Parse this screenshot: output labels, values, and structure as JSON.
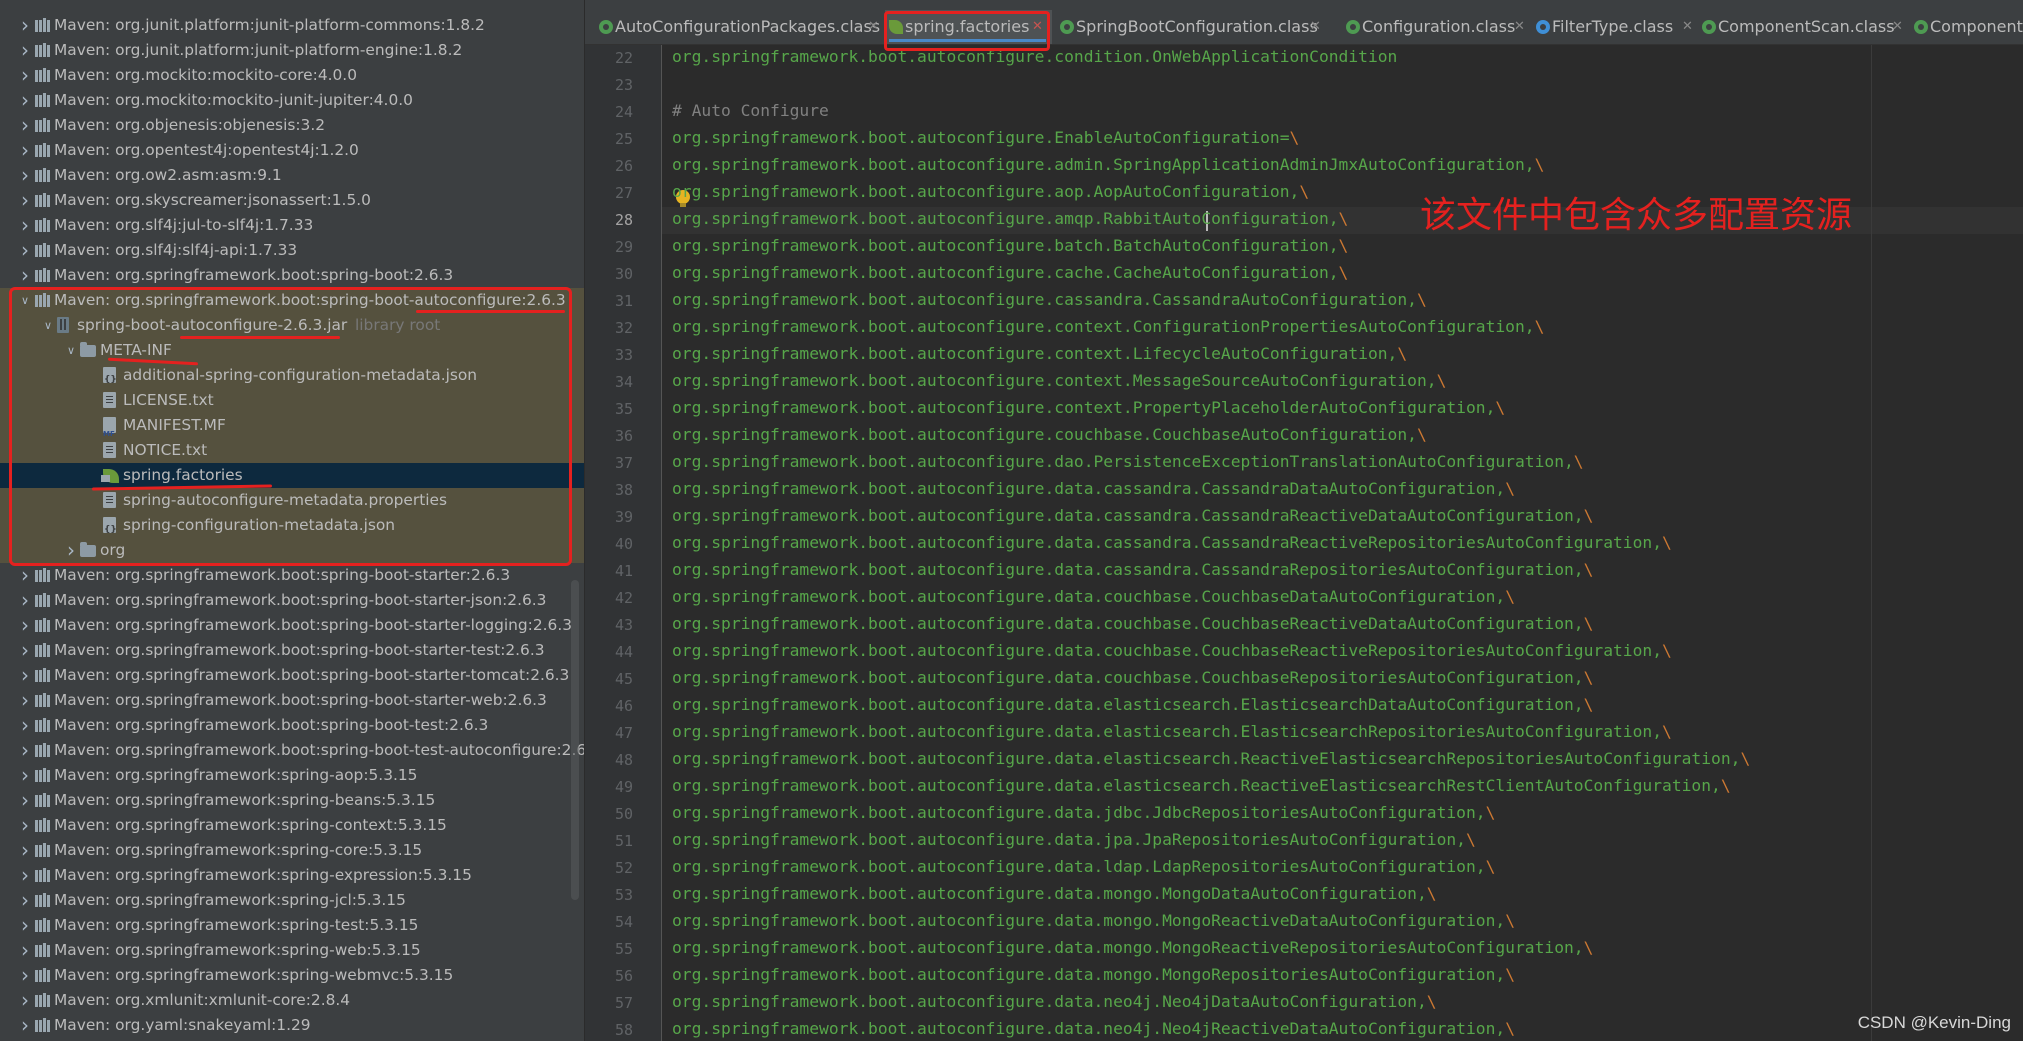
{
  "tree": {
    "rows": [
      {
        "label": "Maven: org.junit.platform:junit-platform-commons:1.8.2",
        "indent": 0,
        "chevron": "right",
        "icon": "library"
      },
      {
        "label": "Maven: org.junit.platform:junit-platform-engine:1.8.2",
        "indent": 0,
        "chevron": "right",
        "icon": "library"
      },
      {
        "label": "Maven: org.mockito:mockito-core:4.0.0",
        "indent": 0,
        "chevron": "right",
        "icon": "library"
      },
      {
        "label": "Maven: org.mockito:mockito-junit-jupiter:4.0.0",
        "indent": 0,
        "chevron": "right",
        "icon": "library"
      },
      {
        "label": "Maven: org.objenesis:objenesis:3.2",
        "indent": 0,
        "chevron": "right",
        "icon": "library"
      },
      {
        "label": "Maven: org.opentest4j:opentest4j:1.2.0",
        "indent": 0,
        "chevron": "right",
        "icon": "library"
      },
      {
        "label": "Maven: org.ow2.asm:asm:9.1",
        "indent": 0,
        "chevron": "right",
        "icon": "library"
      },
      {
        "label": "Maven: org.skyscreamer:jsonassert:1.5.0",
        "indent": 0,
        "chevron": "right",
        "icon": "library"
      },
      {
        "label": "Maven: org.slf4j:jul-to-slf4j:1.7.33",
        "indent": 0,
        "chevron": "right",
        "icon": "library"
      },
      {
        "label": "Maven: org.slf4j:slf4j-api:1.7.33",
        "indent": 0,
        "chevron": "right",
        "icon": "library"
      },
      {
        "label": "Maven: org.springframework.boot:spring-boot:2.6.3",
        "indent": 0,
        "chevron": "right",
        "icon": "library"
      },
      {
        "label": "Maven: org.springframework.boot:spring-boot-autoconfigure:2.6.3",
        "indent": 0,
        "chevron": "down",
        "icon": "library",
        "highlight": true
      },
      {
        "label": "spring-boot-autoconfigure-2.6.3.jar",
        "sub": "library root",
        "indent": 1,
        "chevron": "down",
        "icon": "jar",
        "highlight": true
      },
      {
        "label": "META-INF",
        "indent": 2,
        "chevron": "down",
        "icon": "folder",
        "highlight": true
      },
      {
        "label": "additional-spring-configuration-metadata.json",
        "indent": 3,
        "chevron": "",
        "icon": "json",
        "highlight": true
      },
      {
        "label": "LICENSE.txt",
        "indent": 3,
        "chevron": "",
        "icon": "file",
        "highlight": true
      },
      {
        "label": "MANIFEST.MF",
        "indent": 3,
        "chevron": "",
        "icon": "mf",
        "highlight": true
      },
      {
        "label": "NOTICE.txt",
        "indent": 3,
        "chevron": "",
        "icon": "file",
        "highlight": true
      },
      {
        "label": "spring.factories",
        "indent": 3,
        "chevron": "",
        "icon": "leaf",
        "selected": true
      },
      {
        "label": "spring-autoconfigure-metadata.properties",
        "indent": 3,
        "chevron": "",
        "icon": "file",
        "highlight": true
      },
      {
        "label": "spring-configuration-metadata.json",
        "indent": 3,
        "chevron": "",
        "icon": "json",
        "highlight": true
      },
      {
        "label": "org",
        "indent": 2,
        "chevron": "right",
        "icon": "folder",
        "highlight": true
      },
      {
        "label": "Maven: org.springframework.boot:spring-boot-starter:2.6.3",
        "indent": 0,
        "chevron": "right",
        "icon": "library"
      },
      {
        "label": "Maven: org.springframework.boot:spring-boot-starter-json:2.6.3",
        "indent": 0,
        "chevron": "right",
        "icon": "library"
      },
      {
        "label": "Maven: org.springframework.boot:spring-boot-starter-logging:2.6.3",
        "indent": 0,
        "chevron": "right",
        "icon": "library"
      },
      {
        "label": "Maven: org.springframework.boot:spring-boot-starter-test:2.6.3",
        "indent": 0,
        "chevron": "right",
        "icon": "library"
      },
      {
        "label": "Maven: org.springframework.boot:spring-boot-starter-tomcat:2.6.3",
        "indent": 0,
        "chevron": "right",
        "icon": "library"
      },
      {
        "label": "Maven: org.springframework.boot:spring-boot-starter-web:2.6.3",
        "indent": 0,
        "chevron": "right",
        "icon": "library"
      },
      {
        "label": "Maven: org.springframework.boot:spring-boot-test:2.6.3",
        "indent": 0,
        "chevron": "right",
        "icon": "library"
      },
      {
        "label": "Maven: org.springframework.boot:spring-boot-test-autoconfigure:2.6.",
        "indent": 0,
        "chevron": "right",
        "icon": "library"
      },
      {
        "label": "Maven: org.springframework:spring-aop:5.3.15",
        "indent": 0,
        "chevron": "right",
        "icon": "library"
      },
      {
        "label": "Maven: org.springframework:spring-beans:5.3.15",
        "indent": 0,
        "chevron": "right",
        "icon": "library"
      },
      {
        "label": "Maven: org.springframework:spring-context:5.3.15",
        "indent": 0,
        "chevron": "right",
        "icon": "library"
      },
      {
        "label": "Maven: org.springframework:spring-core:5.3.15",
        "indent": 0,
        "chevron": "right",
        "icon": "library"
      },
      {
        "label": "Maven: org.springframework:spring-expression:5.3.15",
        "indent": 0,
        "chevron": "right",
        "icon": "library"
      },
      {
        "label": "Maven: org.springframework:spring-jcl:5.3.15",
        "indent": 0,
        "chevron": "right",
        "icon": "library"
      },
      {
        "label": "Maven: org.springframework:spring-test:5.3.15",
        "indent": 0,
        "chevron": "right",
        "icon": "library"
      },
      {
        "label": "Maven: org.springframework:spring-web:5.3.15",
        "indent": 0,
        "chevron": "right",
        "icon": "library"
      },
      {
        "label": "Maven: org.springframework:spring-webmvc:5.3.15",
        "indent": 0,
        "chevron": "right",
        "icon": "library"
      },
      {
        "label": "Maven: org.xmlunit:xmlunit-core:2.8.4",
        "indent": 0,
        "chevron": "right",
        "icon": "library"
      },
      {
        "label": "Maven: org.yaml:snakeyaml:1.29",
        "indent": 0,
        "chevron": "right",
        "icon": "library"
      }
    ]
  },
  "tabs": [
    {
      "label": "AutoConfigurationPackages.class",
      "icon": "class-icon"
    },
    {
      "label": "spring.factories",
      "icon": "spring-leaf-icon",
      "active": true
    },
    {
      "label": "SpringBootConfiguration.class",
      "icon": "class-icon"
    },
    {
      "label": "Configuration.class",
      "icon": "class-icon"
    },
    {
      "label": "FilterType.class",
      "icon": "enum-icon"
    },
    {
      "label": "ComponentScan.class",
      "icon": "class-icon"
    },
    {
      "label": "Component",
      "icon": "class-icon"
    }
  ],
  "editor": {
    "current_line": 28,
    "lines": [
      {
        "n": 22,
        "text": "org.springframework.boot.autoconfigure.condition.OnWebApplicationCondition"
      },
      {
        "n": 23,
        "text": ""
      },
      {
        "n": 24,
        "text": "# Auto Configure",
        "comment": true
      },
      {
        "n": 25,
        "text": "org.springframework.boot.autoconfigure.EnableAutoConfiguration=\\"
      },
      {
        "n": 26,
        "text": "org.springframework.boot.autoconfigure.admin.SpringApplicationAdminJmxAutoConfiguration,\\"
      },
      {
        "n": 27,
        "text": "org.springframework.boot.autoconfigure.aop.AopAutoConfiguration,\\"
      },
      {
        "n": 28,
        "text": "org.springframework.boot.autoconfigure.amqp.RabbitAutoConfiguration,\\"
      },
      {
        "n": 29,
        "text": "org.springframework.boot.autoconfigure.batch.BatchAutoConfiguration,\\"
      },
      {
        "n": 30,
        "text": "org.springframework.boot.autoconfigure.cache.CacheAutoConfiguration,\\"
      },
      {
        "n": 31,
        "text": "org.springframework.boot.autoconfigure.cassandra.CassandraAutoConfiguration,\\"
      },
      {
        "n": 32,
        "text": "org.springframework.boot.autoconfigure.context.ConfigurationPropertiesAutoConfiguration,\\"
      },
      {
        "n": 33,
        "text": "org.springframework.boot.autoconfigure.context.LifecycleAutoConfiguration,\\"
      },
      {
        "n": 34,
        "text": "org.springframework.boot.autoconfigure.context.MessageSourceAutoConfiguration,\\"
      },
      {
        "n": 35,
        "text": "org.springframework.boot.autoconfigure.context.PropertyPlaceholderAutoConfiguration,\\"
      },
      {
        "n": 36,
        "text": "org.springframework.boot.autoconfigure.couchbase.CouchbaseAutoConfiguration,\\"
      },
      {
        "n": 37,
        "text": "org.springframework.boot.autoconfigure.dao.PersistenceExceptionTranslationAutoConfiguration,\\"
      },
      {
        "n": 38,
        "text": "org.springframework.boot.autoconfigure.data.cassandra.CassandraDataAutoConfiguration,\\"
      },
      {
        "n": 39,
        "text": "org.springframework.boot.autoconfigure.data.cassandra.CassandraReactiveDataAutoConfiguration,\\"
      },
      {
        "n": 40,
        "text": "org.springframework.boot.autoconfigure.data.cassandra.CassandraReactiveRepositoriesAutoConfiguration,\\"
      },
      {
        "n": 41,
        "text": "org.springframework.boot.autoconfigure.data.cassandra.CassandraRepositoriesAutoConfiguration,\\"
      },
      {
        "n": 42,
        "text": "org.springframework.boot.autoconfigure.data.couchbase.CouchbaseDataAutoConfiguration,\\"
      },
      {
        "n": 43,
        "text": "org.springframework.boot.autoconfigure.data.couchbase.CouchbaseReactiveDataAutoConfiguration,\\"
      },
      {
        "n": 44,
        "text": "org.springframework.boot.autoconfigure.data.couchbase.CouchbaseReactiveRepositoriesAutoConfiguration,\\"
      },
      {
        "n": 45,
        "text": "org.springframework.boot.autoconfigure.data.couchbase.CouchbaseRepositoriesAutoConfiguration,\\"
      },
      {
        "n": 46,
        "text": "org.springframework.boot.autoconfigure.data.elasticsearch.ElasticsearchDataAutoConfiguration,\\"
      },
      {
        "n": 47,
        "text": "org.springframework.boot.autoconfigure.data.elasticsearch.ElasticsearchRepositoriesAutoConfiguration,\\"
      },
      {
        "n": 48,
        "text": "org.springframework.boot.autoconfigure.data.elasticsearch.ReactiveElasticsearchRepositoriesAutoConfiguration,\\"
      },
      {
        "n": 49,
        "text": "org.springframework.boot.autoconfigure.data.elasticsearch.ReactiveElasticsearchRestClientAutoConfiguration,\\"
      },
      {
        "n": 50,
        "text": "org.springframework.boot.autoconfigure.data.jdbc.JdbcRepositoriesAutoConfiguration,\\"
      },
      {
        "n": 51,
        "text": "org.springframework.boot.autoconfigure.data.jpa.JpaRepositoriesAutoConfiguration,\\"
      },
      {
        "n": 52,
        "text": "org.springframework.boot.autoconfigure.data.ldap.LdapRepositoriesAutoConfiguration,\\"
      },
      {
        "n": 53,
        "text": "org.springframework.boot.autoconfigure.data.mongo.MongoDataAutoConfiguration,\\"
      },
      {
        "n": 54,
        "text": "org.springframework.boot.autoconfigure.data.mongo.MongoReactiveDataAutoConfiguration,\\"
      },
      {
        "n": 55,
        "text": "org.springframework.boot.autoconfigure.data.mongo.MongoReactiveRepositoriesAutoConfiguration,\\"
      },
      {
        "n": 56,
        "text": "org.springframework.boot.autoconfigure.data.mongo.MongoRepositoriesAutoConfiguration,\\"
      },
      {
        "n": 57,
        "text": "org.springframework.boot.autoconfigure.data.neo4j.Neo4jDataAutoConfiguration,\\"
      },
      {
        "n": 58,
        "text": "org.springframework.boot.autoconfigure.data.neo4j.Neo4jReactiveDataAutoConfiguration,\\"
      }
    ]
  },
  "annotation": {
    "text": "该文件中包含众多配置资源",
    "color": "#e5211f"
  },
  "watermark": "CSDN @Kevin-Ding",
  "colors": {
    "tree_bg": "#3c3f41",
    "editor_bg": "#2b2b2b",
    "highlight_bg": "#55513e",
    "selected_bg": "#0d293e",
    "code_green": "#57a64a",
    "line_number": "#606366"
  }
}
